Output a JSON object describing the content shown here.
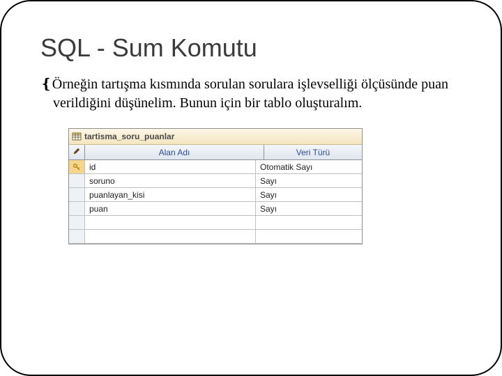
{
  "slide": {
    "title": "SQL - Sum Komutu",
    "bullet_glyph": "❴",
    "paragraph": "Örneğin tartışma kısmında sorulan sorulara işlevselliği ölçüsünde puan verildiğini düşünelim. Bunun için bir tablo oluşturalım."
  },
  "designer": {
    "tab_label": "tartisma_soru_puanlar",
    "columns": {
      "field": "Alan Adı",
      "type": "Veri Türü"
    },
    "rows": [
      {
        "selected": true,
        "pk": true,
        "name": "id",
        "type": "Otomatik Sayı"
      },
      {
        "selected": false,
        "pk": false,
        "name": "soruno",
        "type": "Sayı"
      },
      {
        "selected": false,
        "pk": false,
        "name": "puanlayan_kisi",
        "type": "Sayı"
      },
      {
        "selected": false,
        "pk": false,
        "name": "puan",
        "type": "Sayı"
      },
      {
        "selected": false,
        "pk": false,
        "name": "",
        "type": ""
      },
      {
        "selected": false,
        "pk": false,
        "name": "",
        "type": ""
      }
    ]
  }
}
